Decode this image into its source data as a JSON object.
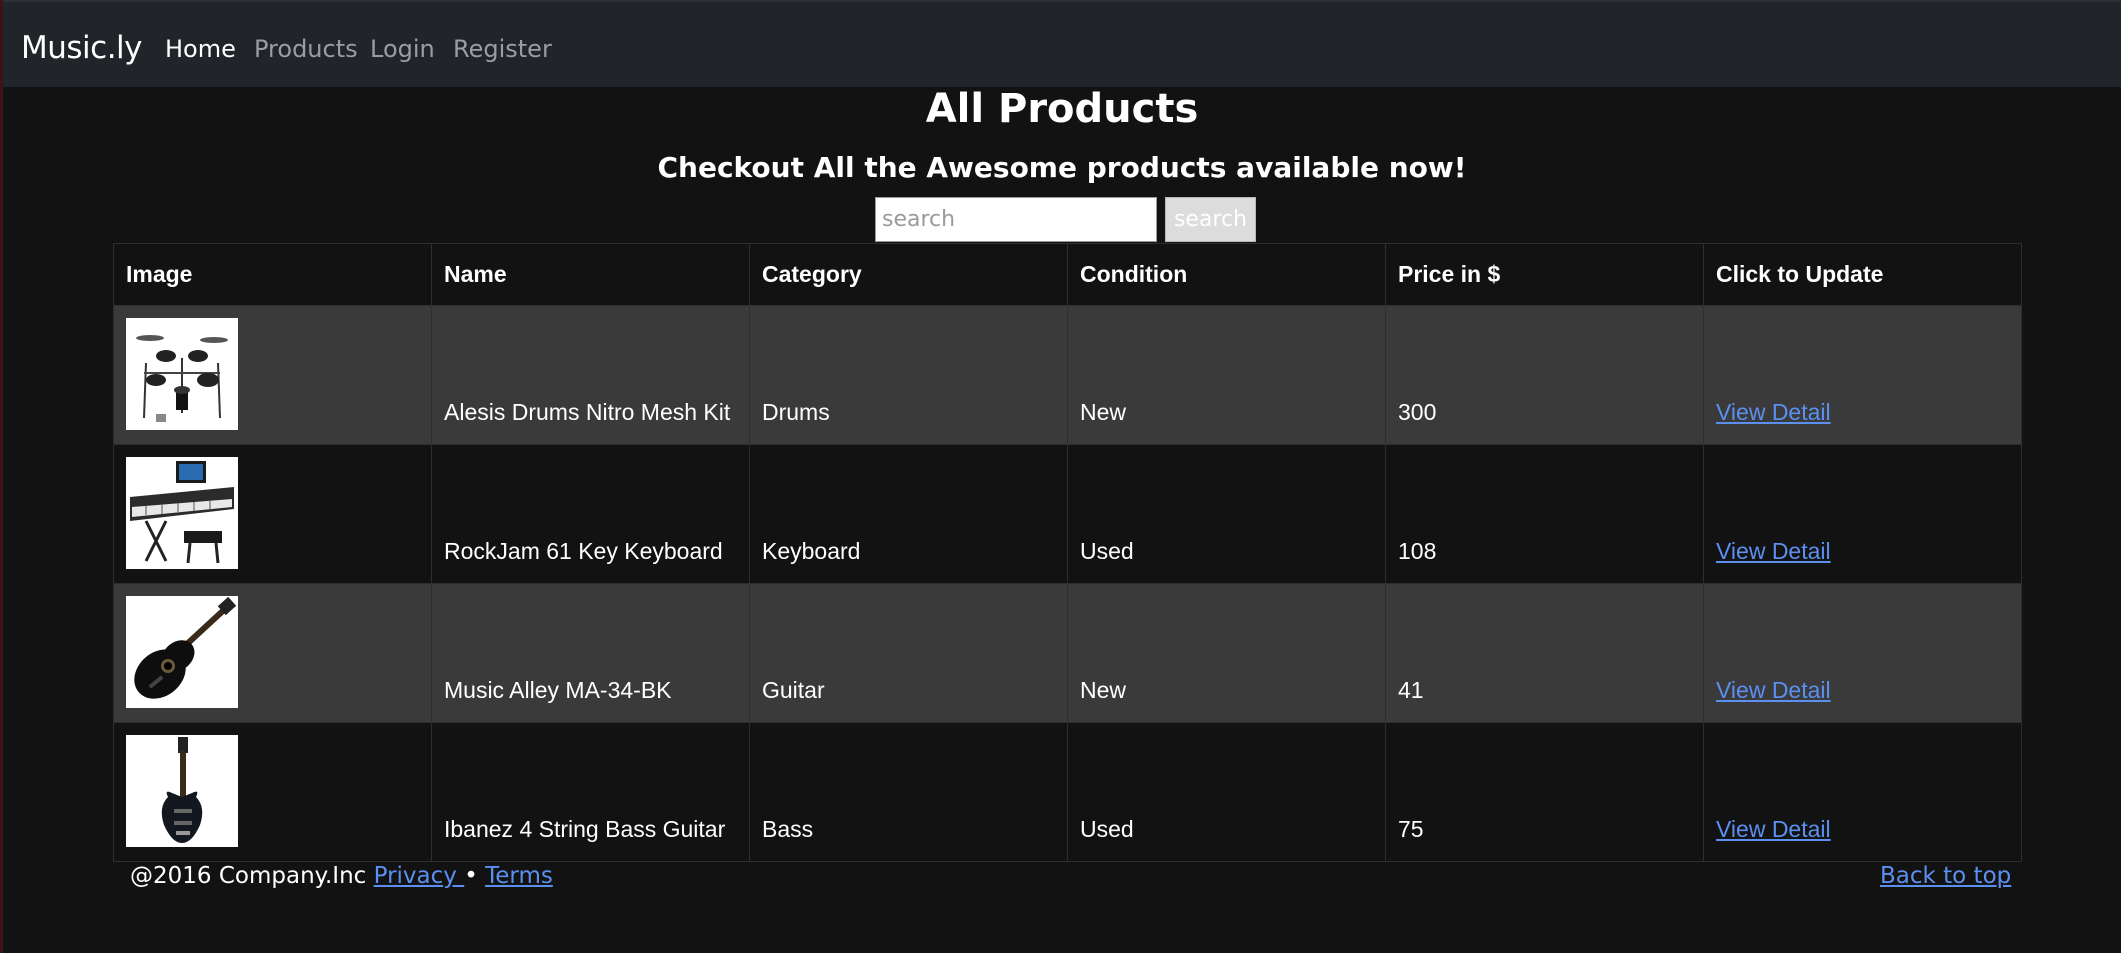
{
  "navbar": {
    "brand": "Music.ly",
    "links": [
      "Home",
      "Products",
      "Login",
      "Register"
    ],
    "active": "Home"
  },
  "header": {
    "title": "All Products",
    "subtitle": "Checkout All the Awesome products available now!"
  },
  "search": {
    "placeholder": "search",
    "value": "",
    "button_label": "search"
  },
  "table": {
    "columns": [
      "Image",
      "Name",
      "Category",
      "Condition",
      "Price in $",
      "Click to Update"
    ],
    "rows": [
      {
        "image": "drum-kit-image",
        "name": "Alesis Drums Nitro Mesh Kit",
        "category": "Drums",
        "condition": "New",
        "price": "300",
        "action": "View Detail"
      },
      {
        "image": "keyboard-image",
        "name": "RockJam 61 Key Keyboard",
        "category": "Keyboard",
        "condition": "Used",
        "price": "108",
        "action": "View Detail"
      },
      {
        "image": "acoustic-guitar-image",
        "name": "Music Alley MA-34-BK",
        "category": "Guitar",
        "condition": "New",
        "price": "41",
        "action": "View Detail"
      },
      {
        "image": "bass-guitar-image",
        "name": "Ibanez 4 String Bass Guitar",
        "category": "Bass",
        "condition": "Used",
        "price": "75",
        "action": "View Detail"
      }
    ]
  },
  "footer": {
    "copyright": "@2016 Company.Inc",
    "privacy": "Privacy ",
    "separator": "•",
    "terms": "Terms",
    "back_to_top": "Back to top"
  },
  "colors": {
    "background": "#121212",
    "navbar": "#212428",
    "striped_row": "#3a3a3a",
    "link": "#5b8ff0"
  }
}
